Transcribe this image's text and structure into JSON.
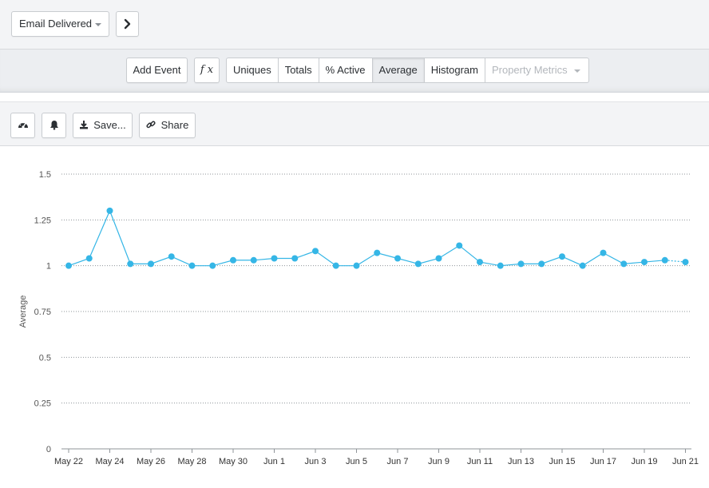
{
  "event_selector": {
    "label": "Email Delivered"
  },
  "toolbar": {
    "add_event": "Add Event",
    "formula": "f x",
    "segments": [
      "Uniques",
      "Totals",
      "% Active",
      "Average",
      "Histogram"
    ],
    "active_segment": "Average",
    "property_metrics": "Property Metrics"
  },
  "actions": {
    "save": "Save...",
    "share": "Share"
  },
  "chart_data": {
    "type": "line",
    "ylabel": "Average",
    "xlabel": "",
    "ylim": [
      0,
      1.5
    ],
    "y_ticks": [
      "0",
      "0.25",
      "0.5",
      "0.75",
      "1",
      "1.25",
      "1.5"
    ],
    "y_tick_values": [
      0,
      0.25,
      0.5,
      0.75,
      1,
      1.25,
      1.5
    ],
    "x_tick_labels": [
      "May 22",
      "May 24",
      "May 26",
      "May 28",
      "May 30",
      "Jun 1",
      "Jun 3",
      "Jun 5",
      "Jun 7",
      "Jun 9",
      "Jun 11",
      "Jun 13",
      "Jun 15",
      "Jun 17",
      "Jun 19",
      "Jun 21"
    ],
    "x": [
      "May 22",
      "May 23",
      "May 24",
      "May 25",
      "May 26",
      "May 27",
      "May 28",
      "May 29",
      "May 30",
      "May 31",
      "Jun 1",
      "Jun 2",
      "Jun 3",
      "Jun 4",
      "Jun 5",
      "Jun 6",
      "Jun 7",
      "Jun 8",
      "Jun 9",
      "Jun 10",
      "Jun 11",
      "Jun 12",
      "Jun 13",
      "Jun 14",
      "Jun 15",
      "Jun 16",
      "Jun 17",
      "Jun 18",
      "Jun 19",
      "Jun 20",
      "Jun 21"
    ],
    "series": [
      {
        "color": "#35b6e6",
        "values": [
          1.0,
          1.04,
          1.3,
          1.01,
          1.01,
          1.05,
          1.0,
          1.0,
          1.03,
          1.03,
          1.04,
          1.04,
          1.08,
          1.0,
          1.0,
          1.07,
          1.04,
          1.01,
          1.04,
          1.11,
          1.02,
          1.0,
          1.01,
          1.01,
          1.05,
          1.0,
          1.07,
          1.01,
          1.02,
          1.03,
          1.02
        ]
      }
    ],
    "last_segment_dotted": true,
    "grid": true
  }
}
